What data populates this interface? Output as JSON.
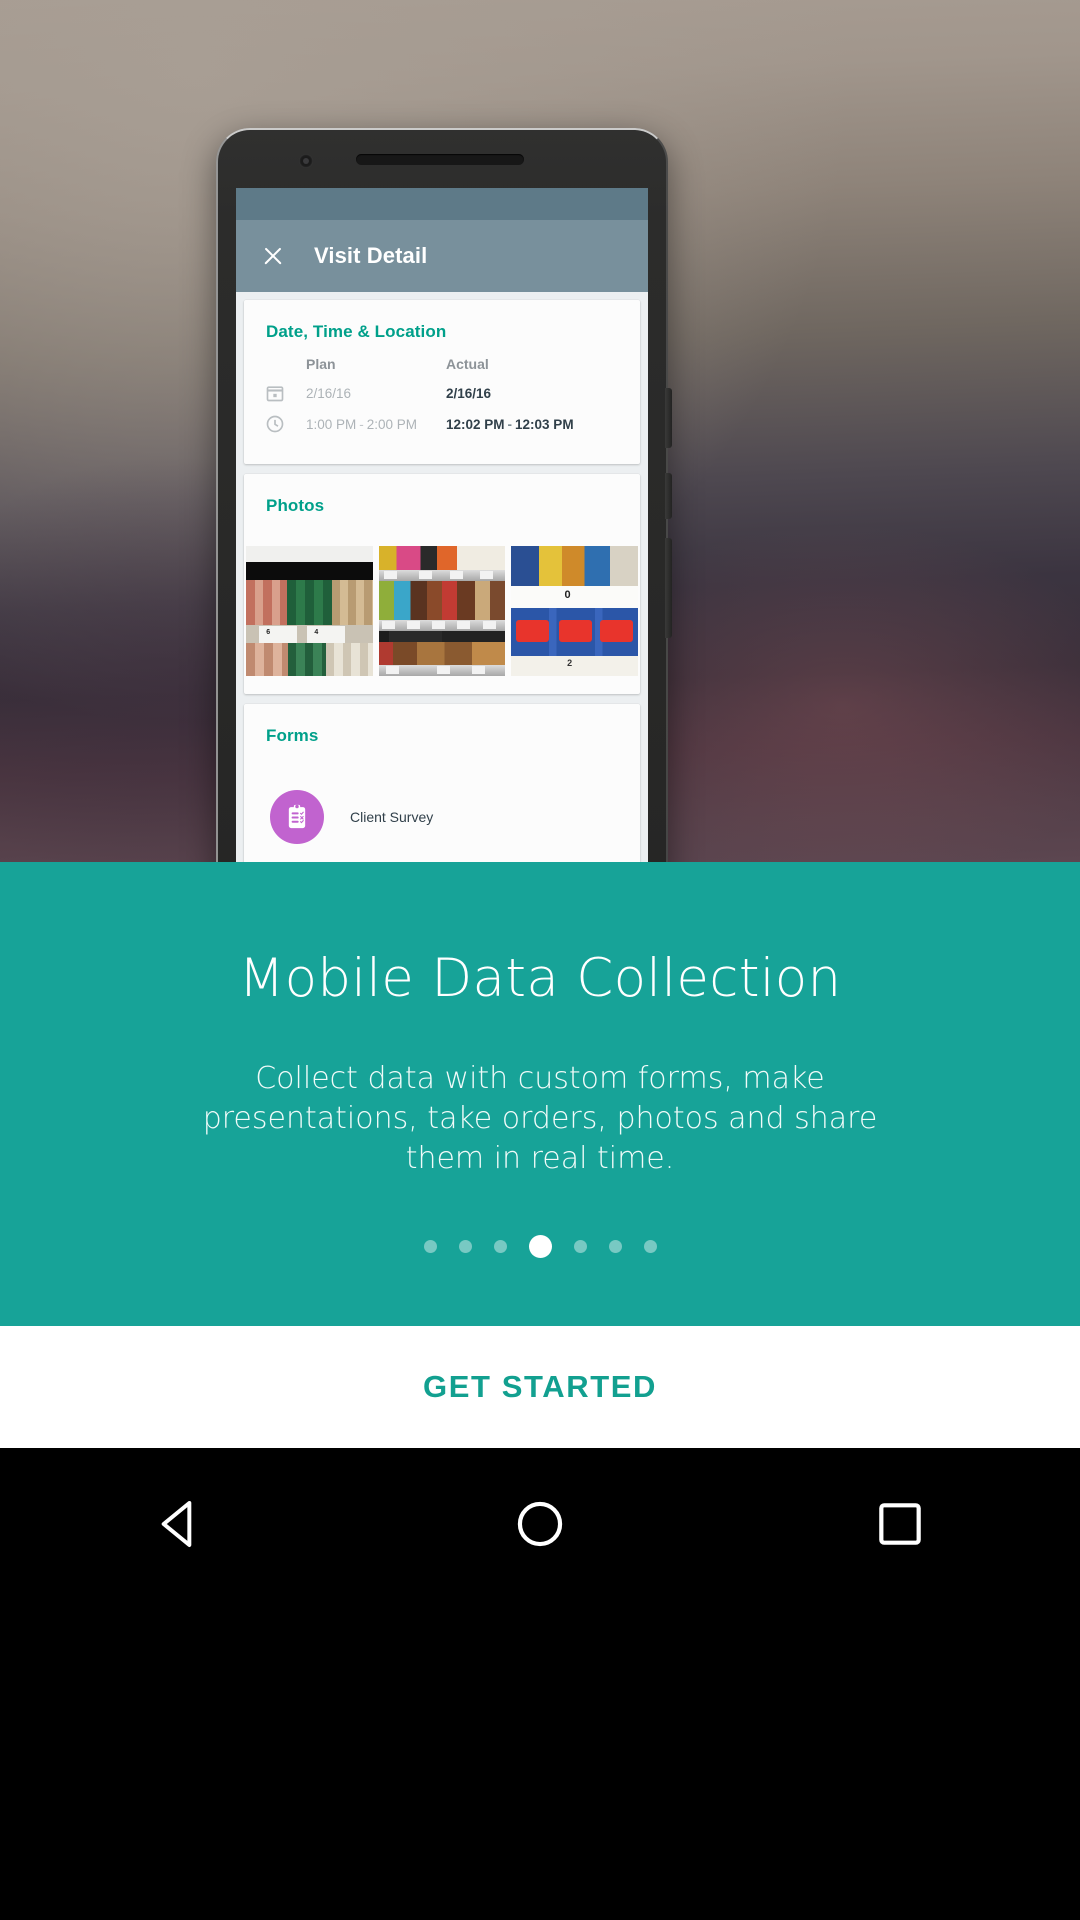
{
  "device_preview": {
    "app_bar": {
      "close_icon": "close-icon",
      "title": "Visit Detail"
    },
    "cards": [
      {
        "title": "Date, Time & Location",
        "columns": [
          "Plan",
          "Actual"
        ],
        "rows": [
          {
            "icon": "calendar-icon",
            "plan": "2/16/16",
            "actual": "2/16/16"
          },
          {
            "icon": "clock-icon",
            "plan_start": "1:00 PM",
            "plan_sep": "-",
            "plan_end": "2:00 PM",
            "actual_start": "12:02 PM",
            "actual_sep": "-",
            "actual_end": "12:03 PM"
          }
        ]
      },
      {
        "title": "Photos",
        "thumbnails": [
          "retail-shelf-beans-photo",
          "retail-shelf-candy-photo",
          "retail-shelf-chips-photo"
        ]
      },
      {
        "title": "Forms",
        "items": [
          {
            "icon": "clipboard-checklist-icon",
            "label": "Client Survey"
          }
        ]
      }
    ]
  },
  "onboarding": {
    "headline": "Mobile Data Collection",
    "description": "Collect data with custom forms, make presentations, take orders, photos and share them in real time.",
    "pager": {
      "total": 7,
      "active_index": 3
    },
    "cta_label": "GET STARTED"
  },
  "navbar": {
    "back_icon": "triangle-back-icon",
    "home_icon": "circle-home-icon",
    "recents_icon": "square-recents-icon"
  },
  "colors": {
    "accent_teal": "#17a398",
    "card_title_teal": "#00a08a",
    "app_bar": "#78909c",
    "status_bar": "#5e7a88",
    "form_icon_purple": "#c163cf"
  }
}
